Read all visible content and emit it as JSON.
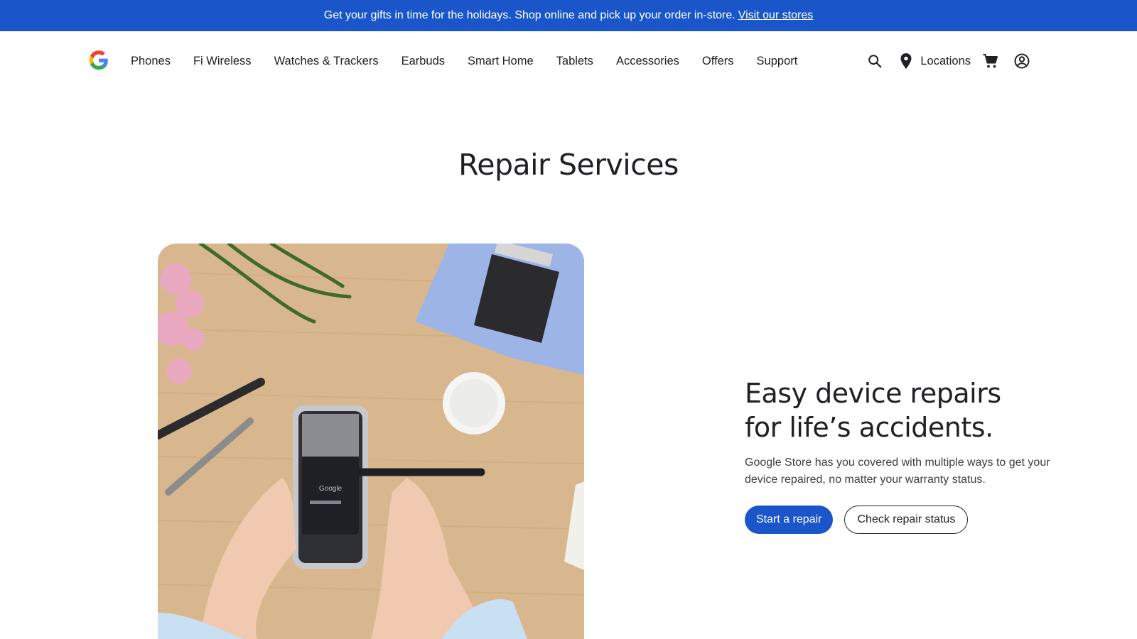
{
  "promo": {
    "text": "Get your gifts in time for the holidays. Shop online and pick up your order in-store.",
    "link": "Visit our stores"
  },
  "nav": {
    "logo_icon": "google-g-logo-icon",
    "links": [
      "Phones",
      "Fi Wireless",
      "Watches & Trackers",
      "Earbuds",
      "Smart Home",
      "Tablets",
      "Accessories",
      "Offers",
      "Support"
    ],
    "locations": "Locations",
    "icons": [
      "search-icon",
      "location-pin-icon",
      "cart-icon",
      "account-icon"
    ]
  },
  "page": {
    "title": "Repair Services"
  },
  "hero": {
    "heading_line1": "Easy device repairs",
    "heading_line2": "for life’s accidents.",
    "body": "Google Store has you covered with multiple ways to get your device repaired, no matter your warranty status.",
    "primary_button": "Start a repair",
    "secondary_button": "Check repair status",
    "image_phone_brand": "Google"
  },
  "colors": {
    "brand_blue": "#1a56c9",
    "text": "#202124"
  }
}
